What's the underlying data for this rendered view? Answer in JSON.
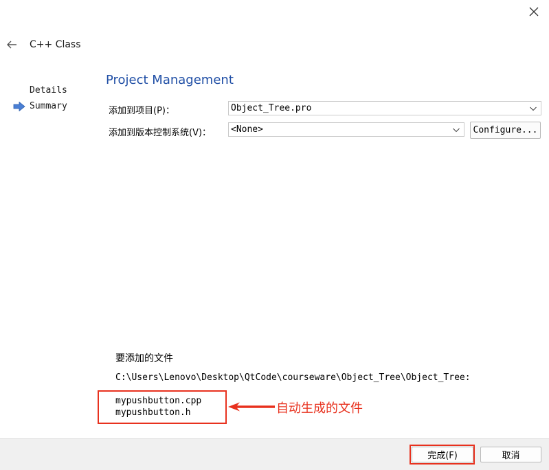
{
  "window": {
    "close_icon": "close-icon",
    "back_icon": "back-arrow-icon",
    "title": "C++ Class"
  },
  "sidebar": {
    "items": [
      {
        "label": "Details",
        "active": false
      },
      {
        "label": "Summary",
        "active": true
      }
    ],
    "active_indicator_icon": "right-arrow-icon",
    "active_indicator_color": "#4a7fd4"
  },
  "main": {
    "heading": "Project Management",
    "heading_color": "#1f4ea5",
    "add_to_project": {
      "label": "添加到项目(P)：",
      "value": "Object_Tree.pro"
    },
    "add_to_vcs": {
      "label": "添加到版本控制系统(V)：",
      "value": "<None>",
      "configure_label": "Configure..."
    },
    "files_section": {
      "heading": "要添加的文件",
      "path": "C:\\Users\\Lenovo\\Desktop\\QtCode\\courseware\\Object_Tree\\Object_Tree:",
      "files": [
        "mypushbutton.cpp",
        "mypushbutton.h"
      ]
    }
  },
  "annotation": {
    "text": "自动生成的文件",
    "color": "#e8311e"
  },
  "footer": {
    "finish_label": "完成(F)",
    "cancel_label": "取消"
  }
}
